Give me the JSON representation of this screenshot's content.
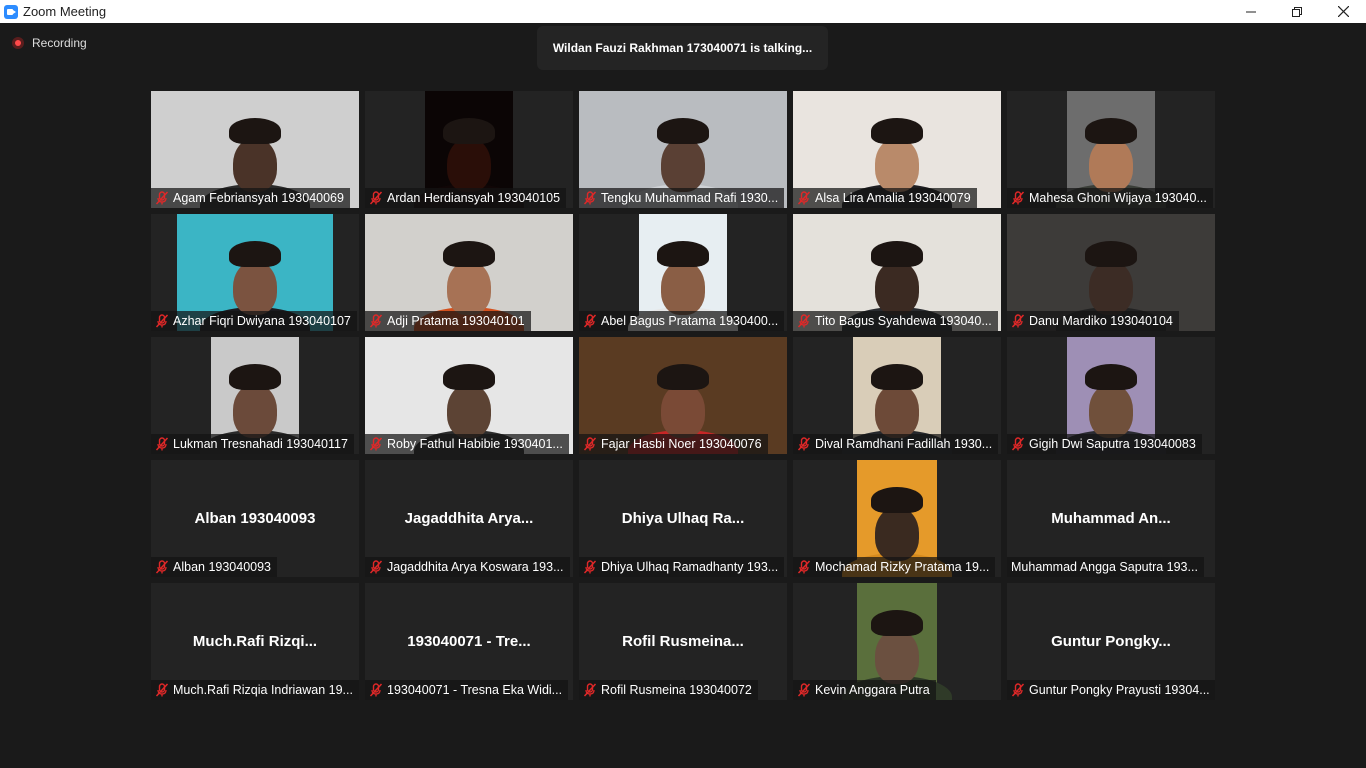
{
  "window": {
    "title": "Zoom Meeting"
  },
  "recording": {
    "label": "Recording"
  },
  "talking": {
    "text": "Wildan Fauzi Rakhman 173040071 is talking..."
  },
  "colors": {
    "accent": "#2d8cff",
    "record": "#ff4a4a",
    "muted": "#e02828"
  },
  "participants": [
    {
      "label": "Agam Febriansyah 193040069",
      "muted": true,
      "video": true
    },
    {
      "label": "Ardan Herdiansyah 193040105",
      "muted": true,
      "video": true
    },
    {
      "label": "Tengku Muhammad Rafi 1930...",
      "muted": true,
      "video": true
    },
    {
      "label": "Alsa Lira Amalia 193040079",
      "muted": true,
      "video": true
    },
    {
      "label": "Mahesa Ghoni Wijaya 193040...",
      "muted": true,
      "video": true
    },
    {
      "label": "Azhar Fiqri Dwiyana 193040107",
      "muted": true,
      "video": true
    },
    {
      "label": "Adji Pratama 193040101",
      "muted": true,
      "video": true
    },
    {
      "label": "Abel Bagus Pratama 1930400...",
      "muted": true,
      "video": true
    },
    {
      "label": "Tito Bagus Syahdewa 193040...",
      "muted": true,
      "video": true
    },
    {
      "label": "Danu Mardiko 193040104",
      "muted": true,
      "video": true
    },
    {
      "label": "Lukman Tresnahadi 193040117",
      "muted": true,
      "video": true
    },
    {
      "label": "Roby Fathul Habibie 1930401...",
      "muted": true,
      "video": true
    },
    {
      "label": "Fajar Hasbi Noer 193040076",
      "muted": true,
      "video": true
    },
    {
      "label": "Dival Ramdhani Fadillah 1930...",
      "muted": true,
      "video": true
    },
    {
      "label": "Gigih Dwi Saputra 193040083",
      "muted": true,
      "video": true
    },
    {
      "label": "Alban 193040093",
      "muted": true,
      "video": false,
      "display_name": "Alban 193040093"
    },
    {
      "label": "Jagaddhita Arya Koswara 193...",
      "muted": true,
      "video": false,
      "display_name": "Jagaddhita  Arya..."
    },
    {
      "label": "Dhiya Ulhaq Ramadhanty 193...",
      "muted": true,
      "video": false,
      "display_name": "Dhiya  Ulhaq  Ra..."
    },
    {
      "label": "Mochamad Rizky Pratama 19...",
      "muted": true,
      "video": true
    },
    {
      "label": "Muhammad Angga Saputra 193...",
      "muted": false,
      "video": false,
      "display_name": "Muhammad  An..."
    },
    {
      "label": "Much.Rafi Rizqia Indriawan 19...",
      "muted": true,
      "video": false,
      "display_name": "Much.Rafi  Rizqi..."
    },
    {
      "label": "193040071 - Tresna Eka Widi...",
      "muted": true,
      "video": false,
      "display_name": "193040071 - Tre..."
    },
    {
      "label": "Rofil Rusmeina 193040072",
      "muted": true,
      "video": false,
      "display_name": "Rofil  Rusmeina..."
    },
    {
      "label": "Kevin Anggara Putra",
      "muted": true,
      "video": true
    },
    {
      "label": "Guntur Pongky Prayusti 19304...",
      "muted": true,
      "video": false,
      "display_name": "Guntur  Pongky..."
    }
  ]
}
